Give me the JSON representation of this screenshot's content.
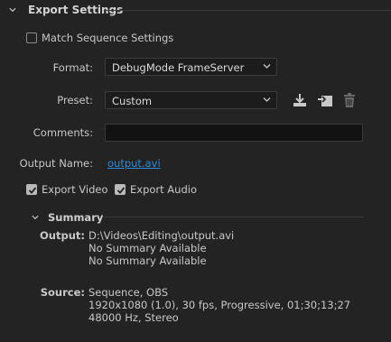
{
  "section": {
    "title": "Export Settings"
  },
  "match_sequence": {
    "label": "Match Sequence Settings",
    "checked": false
  },
  "format": {
    "label": "Format:",
    "value": "DebugMode FrameServer"
  },
  "preset": {
    "label": "Preset:",
    "value": "Custom"
  },
  "comments": {
    "label": "Comments:",
    "value": ""
  },
  "output_name": {
    "label": "Output Name:",
    "value": "output.avi"
  },
  "export_video": {
    "label": "Export Video",
    "checked": true
  },
  "export_audio": {
    "label": "Export Audio",
    "checked": true
  },
  "summary": {
    "title": "Summary",
    "output_label": "Output:",
    "output_lines": [
      "D:\\Videos\\Editing\\output.avi",
      "No Summary Available",
      "No Summary Available"
    ],
    "source_label": "Source:",
    "source_lines": [
      "Sequence, OBS",
      "1920x1080 (1.0), 30 fps, Progressive, 01;30;13;27",
      "48000 Hz, Stereo"
    ]
  },
  "icons": {
    "save_preset": "download-icon",
    "import_preset": "import-preset-icon",
    "delete_preset": "trash-icon"
  },
  "colors": {
    "link": "#2e8bdc",
    "background": "#232323"
  }
}
